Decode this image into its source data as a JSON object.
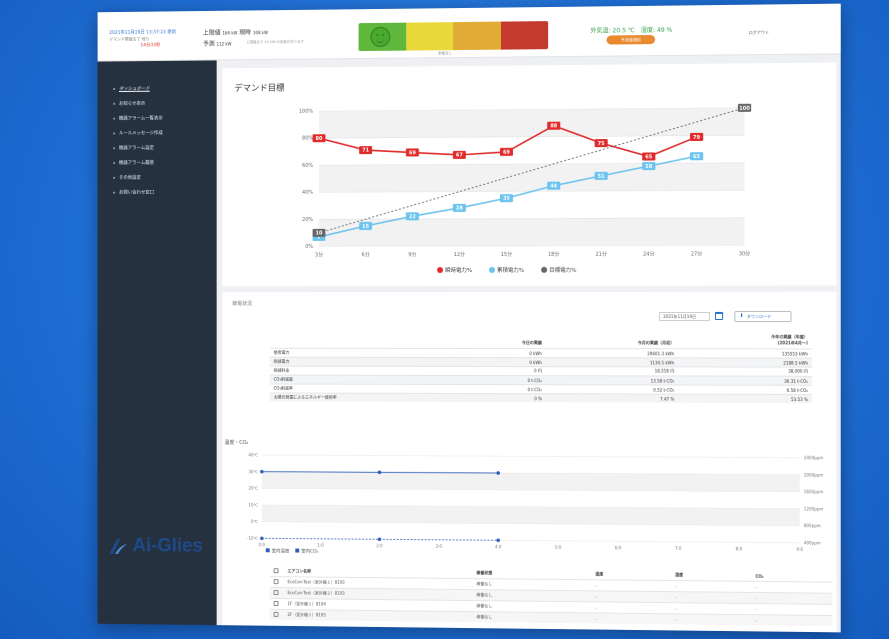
{
  "topbar": {
    "link_text": "2021年11月19日 13:37:23 更新",
    "sub_text": "デマンド警報まで",
    "sub_text2": "残り",
    "red_text": "14分33秒",
    "current_label": "上限値",
    "current_value": "164 kW",
    "current_label2": "現時",
    "current_value2": "108 kW",
    "forecast_label": "予測",
    "forecast_value": "112 kW",
    "forecast_note": "上限値まで 52 kW の余裕があります",
    "demand_caption": "余裕なし",
    "demand_colors": [
      "#5fb83c",
      "#e8d83a",
      "#e1ac35",
      "#c53a2e"
    ],
    "weather": "外気温: 20.5 ℃　湿度: 49 %",
    "alert_button": "予測値通知",
    "logout": "ログアウト"
  },
  "sidebar": {
    "items": [
      {
        "label": "ダッシュボード",
        "active": true
      },
      {
        "label": "お知らせ表示",
        "active": false
      },
      {
        "label": "機器アラーム一覧表示",
        "active": false
      },
      {
        "label": "ルールメッセージ作成",
        "active": false
      },
      {
        "label": "機器アラーム設定",
        "active": false
      },
      {
        "label": "機器アラーム履歴",
        "active": false
      },
      {
        "label": "その他設定",
        "active": false
      },
      {
        "label": "お問い合わせ窓口",
        "active": false
      }
    ],
    "logo": "Ai-Glies"
  },
  "demand": {
    "title": "デマンド目標"
  },
  "chart_data": [
    {
      "type": "line",
      "x": [
        "3分",
        "6分",
        "9分",
        "12分",
        "15分",
        "18分",
        "21分",
        "24分",
        "27分",
        "30分"
      ],
      "ylim": [
        0,
        100
      ],
      "yticks": [
        "0%",
        "20%",
        "40%",
        "60%",
        "80%",
        "100%"
      ],
      "legend_position": "bottom",
      "series": [
        {
          "name": "瞬時電力%",
          "color": "#e02b2b",
          "values": [
            80,
            71,
            69,
            67,
            69,
            88,
            75,
            65,
            79,
            null
          ],
          "labels": [
            "80",
            "71",
            "69",
            "67",
            "69",
            "88",
            "75",
            "65",
            "79",
            ""
          ]
        },
        {
          "name": "累積電力%",
          "color": "#6cc3ee",
          "values": [
            7,
            15,
            22,
            28,
            35,
            44,
            51,
            58,
            65,
            null
          ],
          "labels": [
            "7",
            "15",
            "22",
            "28",
            "35",
            "44",
            "51",
            "58",
            "65",
            ""
          ]
        },
        {
          "name": "目標電力%",
          "color": "#666666",
          "dashed": true,
          "values": [
            10,
            null,
            null,
            null,
            null,
            null,
            null,
            null,
            null,
            100
          ],
          "labels": [
            "10",
            "",
            "",
            "",
            "",
            "",
            "",
            "",
            "",
            "100"
          ]
        }
      ]
    },
    {
      "type": "line",
      "x": [
        "0:0",
        "1:0",
        "2:0",
        "3:0",
        "4:0",
        "5:0",
        "6:0",
        "7:0",
        "8:0",
        "9:0"
      ],
      "yticks_left": [
        "-10℃",
        "0℃",
        "10℃",
        "20℃",
        "30℃",
        "40℃"
      ],
      "yticks_right": [
        "400ppm",
        "800ppm",
        "1200ppm",
        "1600ppm",
        "2000ppm",
        "2400ppm"
      ],
      "legend_position": "bottom-left",
      "series": [
        {
          "name": "室内温度",
          "color": "#2f5fb8",
          "values": [
            30,
            null,
            30,
            null,
            30,
            null,
            null,
            null,
            null,
            null
          ]
        },
        {
          "name": "室内CO₂",
          "color": "#2f5fb8",
          "values": [
            -10,
            null,
            -10,
            null,
            -10,
            null,
            null,
            null,
            null,
            null
          ]
        }
      ]
    }
  ],
  "usage": {
    "title": "節電状況",
    "date": "2021年11月19日",
    "download": "ダウンロード",
    "columns": [
      "",
      "今日の実績",
      "今月の実績（月初）",
      "今年の実績（年度）\n(2021年4月〜)"
    ],
    "rows": [
      [
        "使用電力",
        "0 kWh",
        "29601.3 kWh",
        "135553 kWh"
      ],
      [
        "削減電力",
        "0 kWh",
        "1130.5 kWh",
        "2188.5 kWh"
      ],
      [
        "削減料金",
        "0 円",
        "18,518 円",
        "38,000 円"
      ],
      [
        "CO₂削減量",
        "0 t-CO₂",
        "13.58 t-CO₂",
        "36.31 t-CO₂"
      ],
      [
        "CO₂削減率",
        "0 t-CO₂",
        "0.52 t-CO₂",
        "6.58 t-CO₂"
      ],
      [
        "太陽光発電によるエネルギー使用率",
        "0 %",
        "7.47 %",
        "53.53 %"
      ]
    ]
  },
  "temp": {
    "title": "温度・CO₂"
  },
  "aircon": {
    "columns": [
      "",
      "エアコン名称",
      "稼働状態",
      "温度",
      "湿度",
      "CO₂"
    ],
    "rows": [
      [
        "",
        "EcoCon-Test（室外機１）8193",
        "稼働なし",
        "-",
        "-",
        "-"
      ],
      [
        "",
        "EcoCon-Test（室外機２）8193",
        "稼働なし",
        "-",
        "-",
        "-"
      ],
      [
        "",
        "1F（室外機１）8194",
        "稼働なし",
        "-",
        "-",
        "-"
      ],
      [
        "",
        "2F（室外機１）8195",
        "稼働なし",
        "-",
        "-",
        "-"
      ]
    ]
  }
}
